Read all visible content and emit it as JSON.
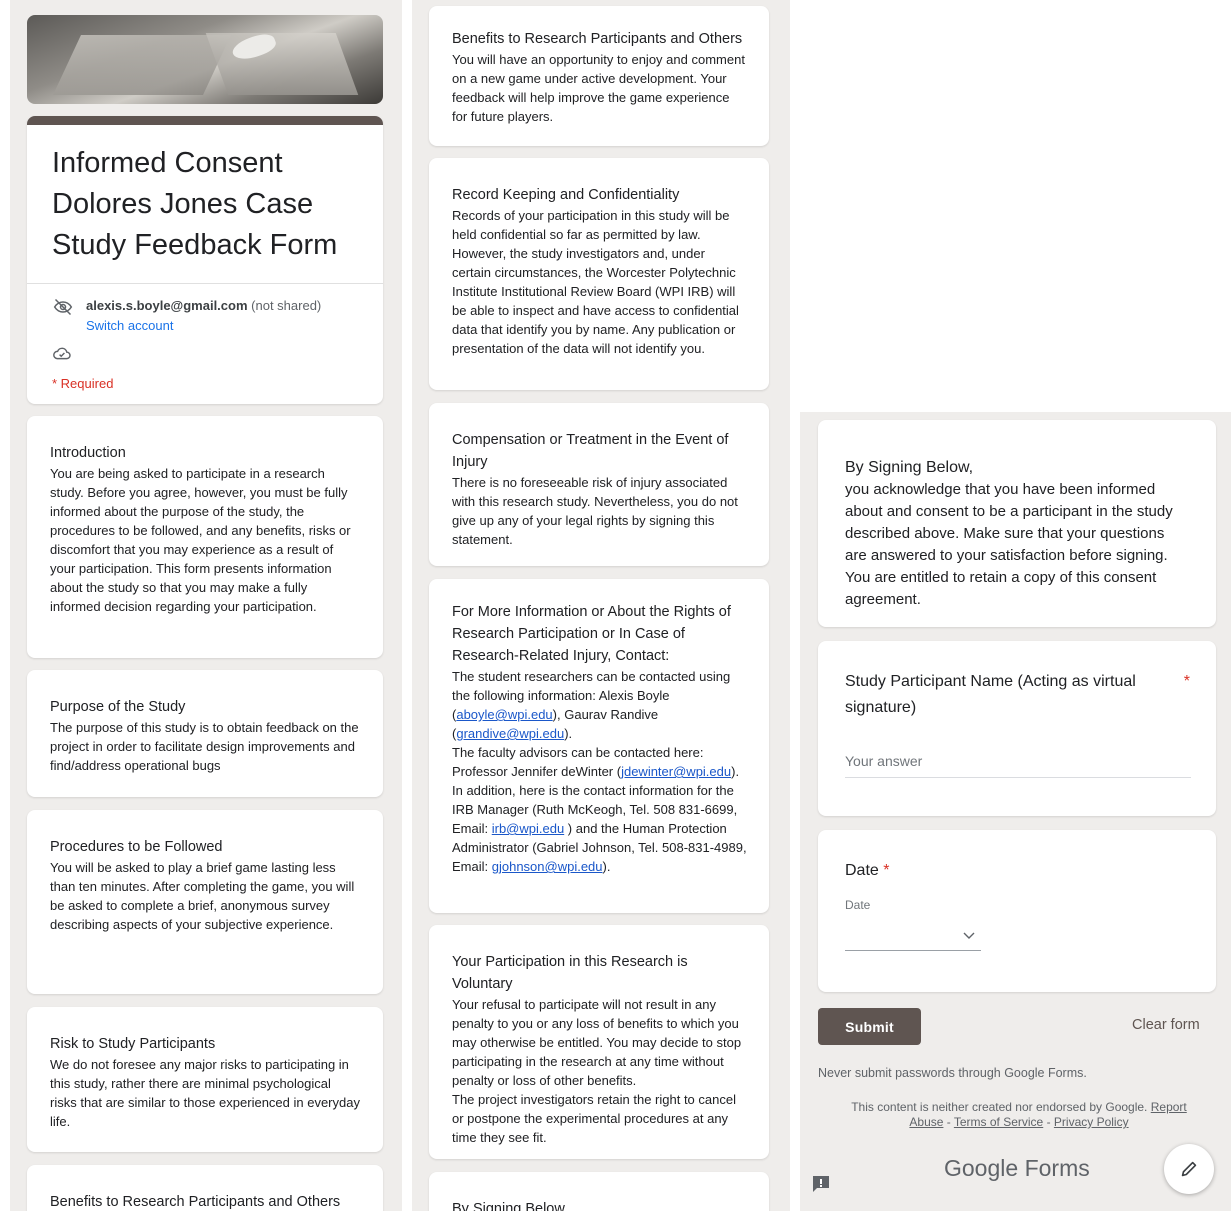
{
  "form": {
    "title": "Informed Consent Dolores Jones Case Study Feedback Form",
    "account_email": "alexis.s.boyle@gmail.com",
    "not_shared": "(not shared)",
    "switch_account": "Switch account",
    "required_note": "* Required"
  },
  "sections": {
    "introduction": {
      "heading": "Introduction",
      "body": "You are being asked to participate in a research study. Before you agree, however, you must be fully informed about the purpose of the study, the procedures to be followed, and any benefits, risks or discomfort that you may experience as a result of your participation. This form presents information about the study so that you may make a fully informed decision regarding your participation."
    },
    "purpose": {
      "heading": "Purpose of the Study",
      "body": "The purpose of this study is to obtain feedback on the project in order to facilitate design improvements and find/address operational bugs"
    },
    "procedures": {
      "heading": "Procedures to be Followed",
      "body": "You will be asked to play a brief game lasting less than ten minutes. After completing the game, you will be asked to complete a brief, anonymous survey describing aspects of your subjective experience."
    },
    "risk": {
      "heading": "Risk to Study Participants",
      "body": "We do not foresee any major risks to participating in this study, rather there are minimal psychological risks that are similar to those experienced in everyday life."
    },
    "benefits": {
      "heading": "Benefits to Research Participants and Others",
      "body": "You will have an opportunity to enjoy and comment on a new game under active development. Your feedback will help improve the game experience for future players."
    },
    "record": {
      "heading": "Record Keeping and Confidentiality",
      "body": "Records of your participation in this study will be held confidential so far as permitted by law. However, the study investigators and, under certain circumstances, the Worcester Polytechnic Institute Institutional Review Board (WPI IRB) will be able to inspect and have access to confidential data that identify you by name. Any publication or presentation of the data will not identify you."
    },
    "compensation": {
      "heading": "Compensation or Treatment in the Event of Injury",
      "body": "There is no foreseeable risk of injury associated with this research study. Nevertheless, you do not give up any of your legal rights by signing this statement."
    },
    "contact": {
      "heading": "For More Information or About the Rights of Research Participation or In Case of Research-Related Injury, Contact:",
      "p1_a": "The student researchers can be contacted using the following information: Alexis Boyle (",
      "email_aboyle": "aboyle@wpi.edu",
      "p1_b": "), Gaurav Randive (",
      "email_grandive": "grandive@wpi.edu",
      "p1_c": ").",
      "p2_a": "The faculty advisors can be contacted here: Professor Jennifer deWinter (",
      "email_jdewinter": "jdewinter@wpi.edu",
      "p2_b": ").",
      "p3_a": "In addition, here is the contact information for the IRB Manager (Ruth McKeogh, Tel. 508 831-6699, Email: ",
      "email_irb": "irb@wpi.edu",
      "p3_b": " ) and the Human Protection Administrator (Gabriel Johnson, Tel. 508-831-4989, Email: ",
      "email_gjohnson": "gjohnson@wpi.edu",
      "p3_c": ")."
    },
    "voluntary": {
      "heading": "Your Participation in this Research is Voluntary",
      "body1": "Your refusal to participate will not result in any penalty to you or any loss of benefits to which you may otherwise be entitled. You may decide to stop participating in the research at any time without penalty or loss of other benefits.",
      "body2": "The project investigators retain the right to cancel or postpone the experimental procedures at any time they see fit."
    },
    "signing": {
      "heading": "By Signing Below,",
      "body": "you acknowledge that you have been informed about and consent to be a participant in the study described above. Make sure that your questions are answered to your satisfaction before signing. You are entitled to retain a copy of this consent agreement."
    }
  },
  "questions": {
    "name": {
      "title": "Study Participant Name (Acting as virtual signature)",
      "required_mark": "*",
      "placeholder": "Your answer"
    },
    "date": {
      "title": "Date",
      "required_mark": "*",
      "sublabel": "Date"
    }
  },
  "footer": {
    "submit": "Submit",
    "clear": "Clear form",
    "never_passwords": "Never submit passwords through Google Forms.",
    "disclaimer_a": "This content is neither created nor endorsed by Google. ",
    "report_abuse": "Report Abuse",
    "sep": " - ",
    "terms": "Terms of Service",
    "privacy": "Privacy Policy",
    "brand_google": "Google",
    "brand_forms": "Forms"
  },
  "icons": [
    "eye-off-icon",
    "cloud-check-icon",
    "chevron-down-icon",
    "pencil-icon",
    "feedback-icon"
  ],
  "colors": {
    "theme": "#5f5551",
    "required": "#d93025",
    "link": "#1a73e8",
    "background": "#efedeb"
  }
}
